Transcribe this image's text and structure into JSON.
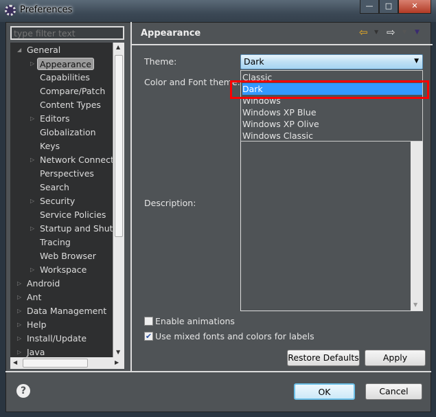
{
  "window": {
    "title": "Preferences",
    "minimize": "—",
    "maximize": "□",
    "close": "✕"
  },
  "filter": {
    "placeholder": "type filter text"
  },
  "tree": {
    "items": [
      {
        "label": "General",
        "level": 0,
        "expanded": true
      },
      {
        "label": "Appearance",
        "level": 1,
        "selected": true,
        "expandable": true
      },
      {
        "label": "Capabilities",
        "level": 1
      },
      {
        "label": "Compare/Patch",
        "level": 1
      },
      {
        "label": "Content Types",
        "level": 1
      },
      {
        "label": "Editors",
        "level": 1,
        "expandable": true
      },
      {
        "label": "Globalization",
        "level": 1
      },
      {
        "label": "Keys",
        "level": 1
      },
      {
        "label": "Network Connecti",
        "level": 1,
        "expandable": true
      },
      {
        "label": "Perspectives",
        "level": 1
      },
      {
        "label": "Search",
        "level": 1
      },
      {
        "label": "Security",
        "level": 1,
        "expandable": true
      },
      {
        "label": "Service Policies",
        "level": 1
      },
      {
        "label": "Startup and Shutd",
        "level": 1,
        "expandable": true
      },
      {
        "label": "Tracing",
        "level": 1
      },
      {
        "label": "Web Browser",
        "level": 1
      },
      {
        "label": "Workspace",
        "level": 1,
        "expandable": true
      },
      {
        "label": "Android",
        "level": 0,
        "expandable": true
      },
      {
        "label": "Ant",
        "level": 0,
        "expandable": true
      },
      {
        "label": "Data Management",
        "level": 0,
        "expandable": true
      },
      {
        "label": "Help",
        "level": 0,
        "expandable": true
      },
      {
        "label": "Install/Update",
        "level": 0,
        "expandable": true
      },
      {
        "label": "Java",
        "level": 0,
        "expandable": true
      }
    ]
  },
  "page": {
    "title": "Appearance",
    "theme_label": "Theme:",
    "theme_value": "Dark",
    "theme_options": [
      "Classic",
      "Dark",
      "Windows",
      "Windows XP Blue",
      "Windows XP Olive",
      "Windows Classic"
    ],
    "color_font_label": "Color and Font theme:",
    "description_label": "Description:",
    "enable_animations": {
      "label": "Enable animations",
      "checked": false
    },
    "mixed_fonts": {
      "label": "Use mixed fonts and colors for labels",
      "checked": true
    },
    "restore_defaults": "Restore Defaults",
    "apply": "Apply"
  },
  "footer": {
    "ok": "OK",
    "cancel": "Cancel",
    "help_icon": "?"
  },
  "colors": {
    "accent_selection": "#3399ff",
    "highlight_box": "#ff0000",
    "panel_bg": "#4f5356",
    "tree_bg": "#2e2f30"
  }
}
